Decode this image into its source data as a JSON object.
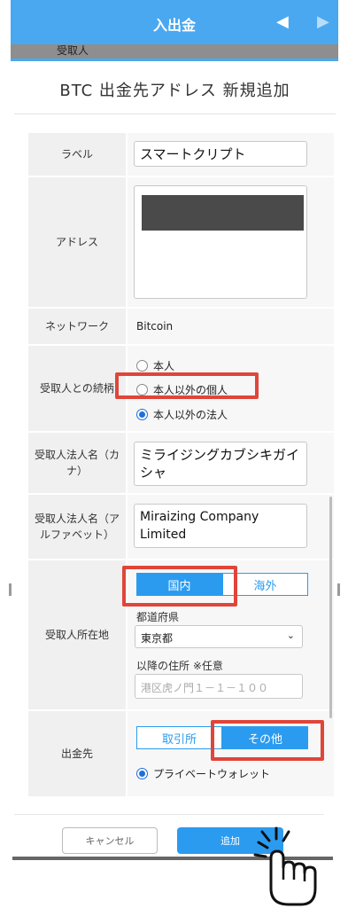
{
  "header": {
    "title": "入出金",
    "prev_icon": "triangle-left",
    "next_icon": "triangle-right"
  },
  "background": {
    "strip_label": "受取人"
  },
  "modal": {
    "title": "BTC 出金先アドレス 新規追加",
    "rows": {
      "label": {
        "label": "ラベル",
        "value": "スマートクリプト"
      },
      "address": {
        "label": "アドレス"
      },
      "network": {
        "label": "ネットワーク",
        "value": "Bitcoin"
      },
      "relation": {
        "label": "受取人との続柄",
        "options": [
          "本人",
          "本人以外の個人",
          "本人以外の法人"
        ],
        "selected": "本人以外の法人"
      },
      "name_kana": {
        "label": "受取人法人名（カナ）",
        "value": "ミライジングカブシキガイシャ"
      },
      "name_alpha": {
        "label": "受取人法人名（アルファベット）",
        "value": "Miraizing Company Limited"
      },
      "location": {
        "label": "受取人所在地",
        "tabs": [
          "国内",
          "海外"
        ],
        "active_tab": "国内",
        "pref_label": "都道府県",
        "pref_value": "東京都",
        "addr_label": "以降の住所 ※任意",
        "addr_placeholder": "港区虎ノ門１－１－１００"
      },
      "destination": {
        "label": "出金先",
        "tabs": [
          "取引所",
          "その他"
        ],
        "active_tab": "その他",
        "option": "プライベートウォレット"
      }
    }
  },
  "footer": {
    "cancel": "キャンセル",
    "add": "追加"
  },
  "colors": {
    "accent": "#2b9bf0",
    "header": "#4aa8f0",
    "highlight": "#e0453a"
  }
}
